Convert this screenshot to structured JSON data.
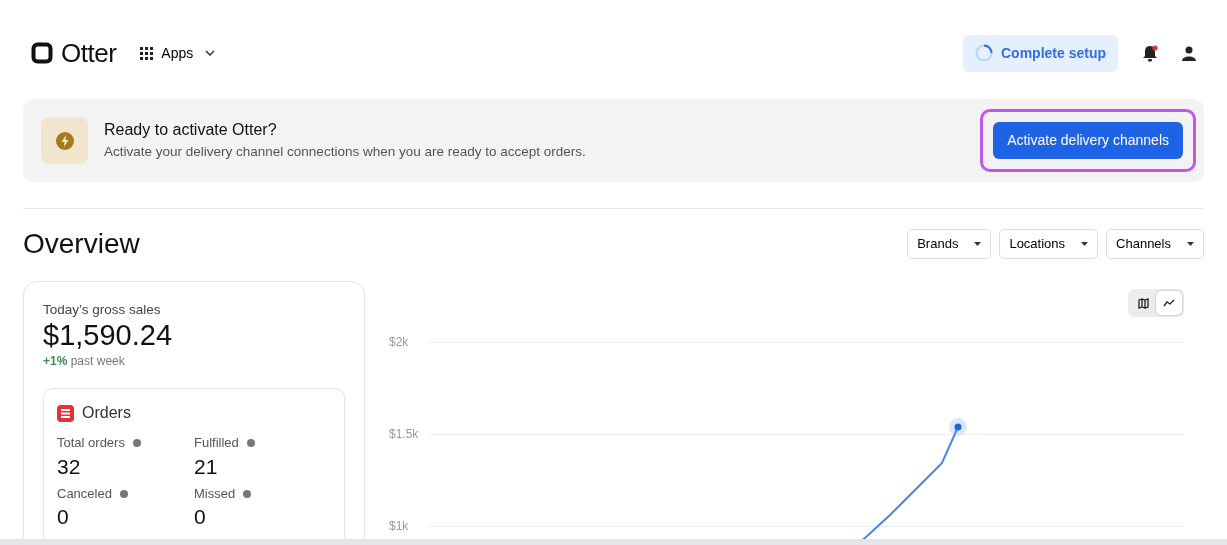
{
  "header": {
    "logo": "Otter",
    "apps_menu": "Apps",
    "setup_button": "Complete setup",
    "notifications_unread": true
  },
  "banner": {
    "title": "Ready to activate Otter?",
    "text": "Activate your delivery channel connections when you are ready to accept orders.",
    "button": "Activate delivery channels",
    "highlighted": true
  },
  "overview": {
    "title": "Overview",
    "filters": [
      "Brands",
      "Locations",
      "Channels"
    ]
  },
  "sales": {
    "label": "Today’s gross sales",
    "amount": "$1,590.24",
    "change": "+1%",
    "change_text": "past week"
  },
  "orders": {
    "title": "Orders",
    "metrics": [
      {
        "label": "Total orders",
        "value": "32"
      },
      {
        "label": "Fulfilled",
        "value": "21"
      },
      {
        "label": "Canceled",
        "value": "0"
      },
      {
        "label": "Missed",
        "value": "0"
      }
    ]
  },
  "chart": {
    "view_toggle": [
      {
        "kind": "map",
        "selected": false
      },
      {
        "kind": "line",
        "selected": true
      }
    ],
    "y_ticks": [
      "$2k",
      "$1.5k",
      "$1k"
    ]
  }
}
